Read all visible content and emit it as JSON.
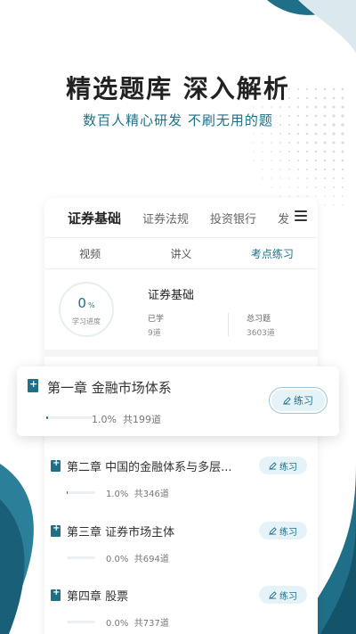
{
  "headline": "精选题库  深入解析",
  "subline": "数百人精心研发  不刷无用的题",
  "tabs": [
    {
      "label": "证券基础",
      "active": true
    },
    {
      "label": "证券法规",
      "active": false
    },
    {
      "label": "投资银行",
      "active": false
    },
    {
      "label": "发",
      "active": false
    }
  ],
  "subtabs": [
    {
      "label": "视频",
      "active": false
    },
    {
      "label": "讲义",
      "active": false
    },
    {
      "label": "考点练习",
      "active": true
    }
  ],
  "summary": {
    "progress_value": "0",
    "progress_unit": "%",
    "progress_label": "学习进度",
    "title": "证券基础",
    "learned_label": "已学",
    "learned_value": "9道",
    "total_label": "总习题",
    "total_value": "3603道"
  },
  "practice_label": "练习",
  "chapters": [
    {
      "title": "第一章 金融市场体系",
      "percent": "1.0%",
      "count": "共199道",
      "progress": 0.01
    },
    {
      "title": "第二章 中国的金融体系与多层...",
      "percent": "1.0%",
      "count": "共346道",
      "progress": 0.01
    },
    {
      "title": "第三章 证券市场主体",
      "percent": "0.0%",
      "count": "共694道",
      "progress": 0.0
    },
    {
      "title": "第四章 股票",
      "percent": "0.0%",
      "count": "共737道",
      "progress": 0.0
    }
  ],
  "colors": {
    "accent": "#1f6f88",
    "accent_light": "#e5f3f8",
    "wave": "#1f6f88"
  }
}
